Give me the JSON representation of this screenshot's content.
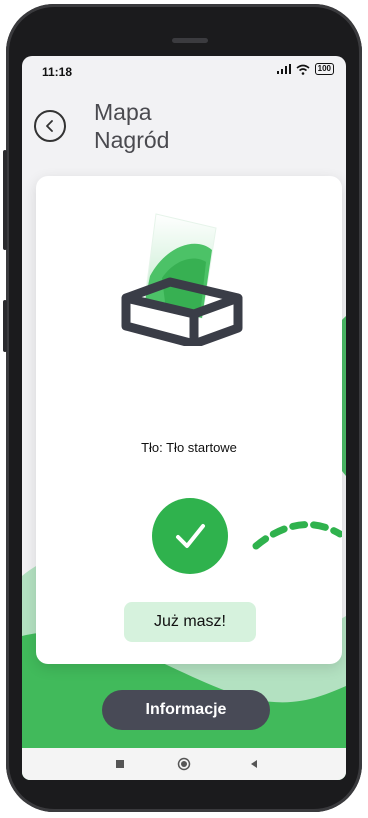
{
  "status_bar": {
    "time": "11:18",
    "battery": "100"
  },
  "header": {
    "title_line1": "Mapa",
    "title_line2": "Nagród"
  },
  "reward": {
    "background_label": "Tło: Tło startowe",
    "owned_label": "Już masz!"
  },
  "actions": {
    "info_label": "Informacje"
  },
  "colors": {
    "accent_green": "#2fb24d",
    "light_green": "#d6f2dd",
    "button_dark": "#484a56"
  },
  "icons": {
    "back": "chevron-left-circle-icon",
    "check": "check-icon",
    "nav_recent": "square-icon",
    "nav_home": "circle-icon",
    "nav_back": "triangle-left-icon"
  }
}
